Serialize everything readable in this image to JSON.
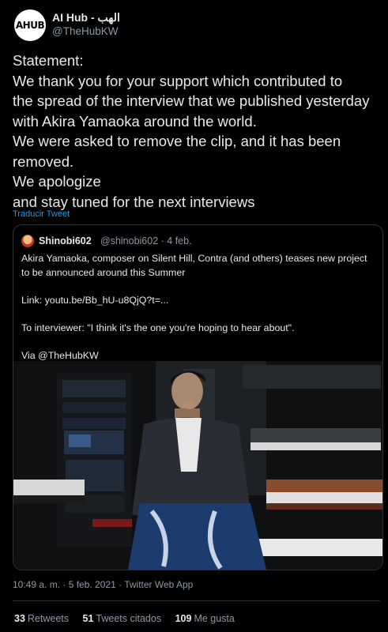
{
  "author": {
    "name": "AI Hub - الهب",
    "handle": "@TheHubKW",
    "avatar_logo": "AHUB",
    "more_icon": "…"
  },
  "tweet": {
    "lines": [
      "Statement:",
      "We thank you for your support which contributed to",
      "the spread of the interview that we published yesterday",
      "with Akira Yamaoka around the world.",
      "We were asked to remove the clip, and it has been",
      "removed.",
      "We apologize",
      "and stay tuned  for the next interviews"
    ],
    "translate_label": "Traducir Tweet"
  },
  "quote": {
    "name": "Shinobi602",
    "handle": "@shinobi602 · 4 feb.",
    "body_1": "Akira Yamaoka, composer on Silent Hill, Contra (and others) teases new project to be announced around this Summer",
    "body_2": "Link: youtu.be/Bb_hU-u8QjQ?t=...",
    "body_3": "To interviewer: \"I think it's the one you're hoping to hear about\".",
    "body_4": "Via @TheHubKW"
  },
  "meta": {
    "timestamp": "10:49 a. m. · 5 feb. 2021 · Twitter Web App"
  },
  "stats": {
    "retweets_count": "33",
    "retweets_label": "Retweets",
    "quotes_count": "51",
    "quotes_label": "Tweets citados",
    "likes_count": "109",
    "likes_label": "Me gusta"
  },
  "colors": {
    "background": "#000000",
    "text": "#e7e9ea",
    "muted": "#8b98a5",
    "link": "#1d9bf0",
    "border": "#2f3336"
  }
}
